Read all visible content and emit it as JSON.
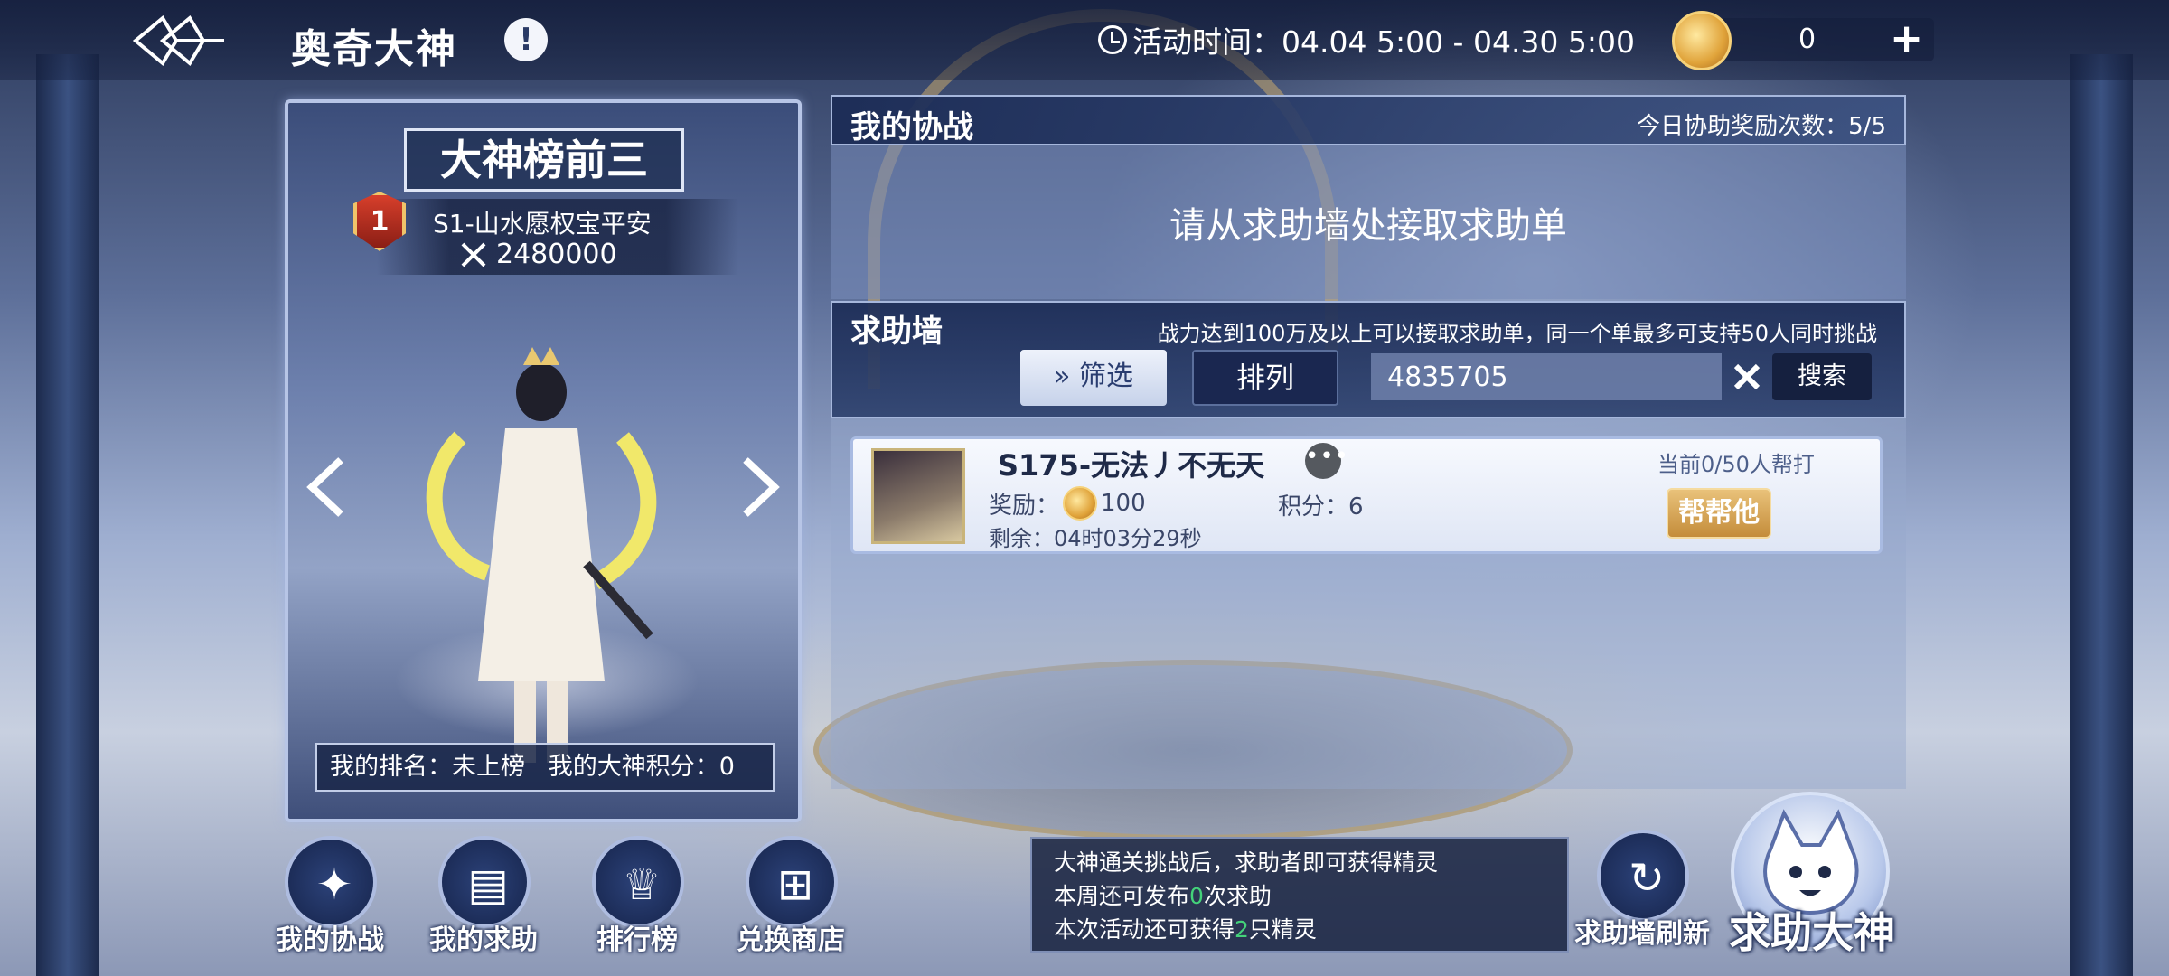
{
  "header": {
    "title": "奥奇大神",
    "info_icon": "exclamation-icon",
    "activity_time": "活动时间：04.04 5:00 - 04.30 5:00",
    "currency_value": "0",
    "plus_label": "+"
  },
  "ranking": {
    "title": "大神榜前三",
    "rank_number": "1",
    "player_name": "S1-山水愿权宝平安",
    "power": "2480000",
    "footer": "我的排名：未上榜   我的大神积分：0"
  },
  "my_assist": {
    "title": "我的协战",
    "daily_reward_count": "今日协助奖励次数：5/5",
    "empty_message": "请从求助墙处接取求助单"
  },
  "help_wall": {
    "title": "求助墙",
    "description": "战力达到100万及以上可以接取求助单，同一个单最多可支持50人同时挑战",
    "filter_label": "筛选",
    "sort_label": "排列",
    "search_value": "4835705",
    "search_button": "搜索",
    "requests": [
      {
        "name": "S175-无法丿不无天",
        "reward_label": "奖励：",
        "reward_value": "100",
        "score": "积分：6",
        "remaining": "剩余：04时03分29秒",
        "status": "当前0/50人帮打",
        "action_label": "帮帮他"
      }
    ]
  },
  "bottom_nav": [
    {
      "label": "我的协战",
      "icon": "compass-icon"
    },
    {
      "label": "我的求助",
      "icon": "book-icon"
    },
    {
      "label": "排行榜",
      "icon": "trophy-icon"
    },
    {
      "label": "兑换商店",
      "icon": "cart-icon"
    }
  ],
  "tips": {
    "line1": "大神通关挑战后，求助者即可获得精灵",
    "line2_prefix": "本周还可发布",
    "line2_count": "0",
    "line2_suffix": "次求助",
    "line3_prefix": "本次活动还可获得",
    "line3_count": "2",
    "line3_suffix": "只精灵"
  },
  "actions": {
    "refresh_label": "求助墙刷新",
    "summon_label": "求助大神"
  }
}
